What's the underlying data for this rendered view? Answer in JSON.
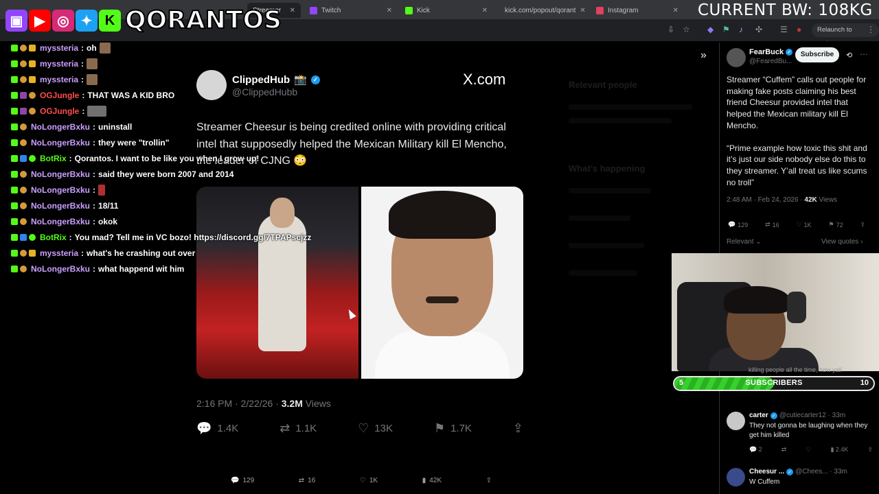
{
  "browser": {
    "tabs": [
      {
        "label": "Streamer",
        "favicon_color": "#e8eaed",
        "active": true
      },
      {
        "label": "Twitch",
        "favicon_color": "#9146ff"
      },
      {
        "label": "Kick",
        "favicon_color": "#53fc18"
      },
      {
        "label": "kick.com/popout/qorant",
        "favicon_color": "#53fc18"
      },
      {
        "label": "Instagram",
        "favicon_color": "#e4405f"
      }
    ],
    "relaunch_label": "Relaunch to update"
  },
  "overlay": {
    "channel_name": "QORANTOS",
    "bandwidth": "CURRENT BW: 108KG",
    "socials": [
      {
        "icon": "twitch-icon",
        "color": "#9146ff",
        "glyph": "▣"
      },
      {
        "icon": "youtube-icon",
        "color": "#ff0000",
        "glyph": "▶"
      },
      {
        "icon": "instagram-icon",
        "color": "#d62976",
        "glyph": "◎"
      },
      {
        "icon": "twitter-icon",
        "color": "#1da1f2",
        "glyph": "✦"
      },
      {
        "icon": "kick-icon",
        "color": "#53fc18",
        "glyph": "K"
      }
    ]
  },
  "chat": {
    "messages": [
      {
        "user": "myssteria",
        "color": "#c9a0ff",
        "text": "oh",
        "emote": "face"
      },
      {
        "user": "myssteria",
        "color": "#c9a0ff",
        "text": "",
        "emote": "face"
      },
      {
        "user": "myssteria",
        "color": "#c9a0ff",
        "text": "",
        "emote": "face"
      },
      {
        "user": "OGJungle",
        "color": "#ff4d4d",
        "text": "THAT WAS A KID BRO",
        "emote": ""
      },
      {
        "user": "OGJungle",
        "color": "#ff4d4d",
        "text": "",
        "emote": "wide"
      },
      {
        "user": "NoLongerBxku",
        "color": "#c9a0ff",
        "text": "uninstall",
        "emote": ""
      },
      {
        "user": "NoLongerBxku",
        "color": "#c9a0ff",
        "text": "they were \"trollin\"",
        "emote": ""
      },
      {
        "user": "BotRix",
        "color": "#53fc18",
        "text": "Qorantos. I want to be like you when I grow up!",
        "emote": ""
      },
      {
        "user": "NoLongerBxku",
        "color": "#c9a0ff",
        "text": "said they were born 2007 and 2014",
        "emote": ""
      },
      {
        "user": "NoLongerBxku",
        "color": "#c9a0ff",
        "text": "",
        "emote": "red"
      },
      {
        "user": "NoLongerBxku",
        "color": "#c9a0ff",
        "text": "18/11",
        "emote": ""
      },
      {
        "user": "NoLongerBxku",
        "color": "#c9a0ff",
        "text": "okok",
        "emote": ""
      },
      {
        "user": "BotRix",
        "color": "#53fc18",
        "text": "You mad? Tell me in VC bozo! https://discord.gg/7TPAPscjzz",
        "emote": ""
      },
      {
        "user": "myssteria",
        "color": "#c9a0ff",
        "text": "what's he crashing out over",
        "emote": ""
      },
      {
        "user": "NoLongerBxku",
        "color": "#c9a0ff",
        "text": "what happend wit him",
        "emote": ""
      }
    ]
  },
  "tweet": {
    "display_name": "ClippedHub",
    "handle": "@ClippedHubb",
    "site_label": "X.com",
    "text": "Streamer Cheesur is being credited online with providing critical intel that supposedly helped the Mexican Military kill El Mencho, the leader of CJNG 😳",
    "time": "2:16 PM · 2/22/26 ·",
    "views": "3.2M",
    "views_label": "Views",
    "replies": "1.4K",
    "reposts": "1.1K",
    "likes": "13K",
    "bookmarks": "1.7K"
  },
  "bottom_bar": {
    "replies": "129",
    "reposts": "16",
    "likes": "1K",
    "views": "42K"
  },
  "right_column": {
    "author": "FearBuck",
    "handle": "@FearedBu...",
    "subscribe_label": "Subscribe",
    "text_1": "Streamer “Cuffem” calls out people for making fake posts claiming his best friend Cheesur provided intel that helped the Mexican military kill El Mencho.",
    "text_2": "“Prime example how toxic this shit and it’s just our side nobody else do this to they streamer. Y’all treat us like scums no troll”",
    "time": "2:48 AM · Feb 24, 2026 ·",
    "views": "42K",
    "views_label": "Views",
    "replies": "129",
    "reposts": "16",
    "likes": "1K",
    "bookmarks": "72",
    "sort_label": "Relevant",
    "view_quotes_label": "View quotes",
    "replies_list": [
      {
        "name": "carter",
        "handle": "@cutiecarter12 · 33m",
        "text": "They not gonna be laughing when they get him killed",
        "replies": "2",
        "views": "2.4K"
      },
      {
        "name": "Cheesur ...",
        "handle": "@Chees... · 33m",
        "text": "W Cuffem",
        "replies": "",
        "views": ""
      }
    ]
  },
  "dim_column": {
    "relevant_people": "Relevant people",
    "whats_happening": "What’s happening"
  },
  "webcam": {
    "caption": "killing people all the time, how yall"
  },
  "sub_goal": {
    "current": "5",
    "label": "SUBSCRIBERS",
    "goal": "10",
    "progress": 0.5
  }
}
